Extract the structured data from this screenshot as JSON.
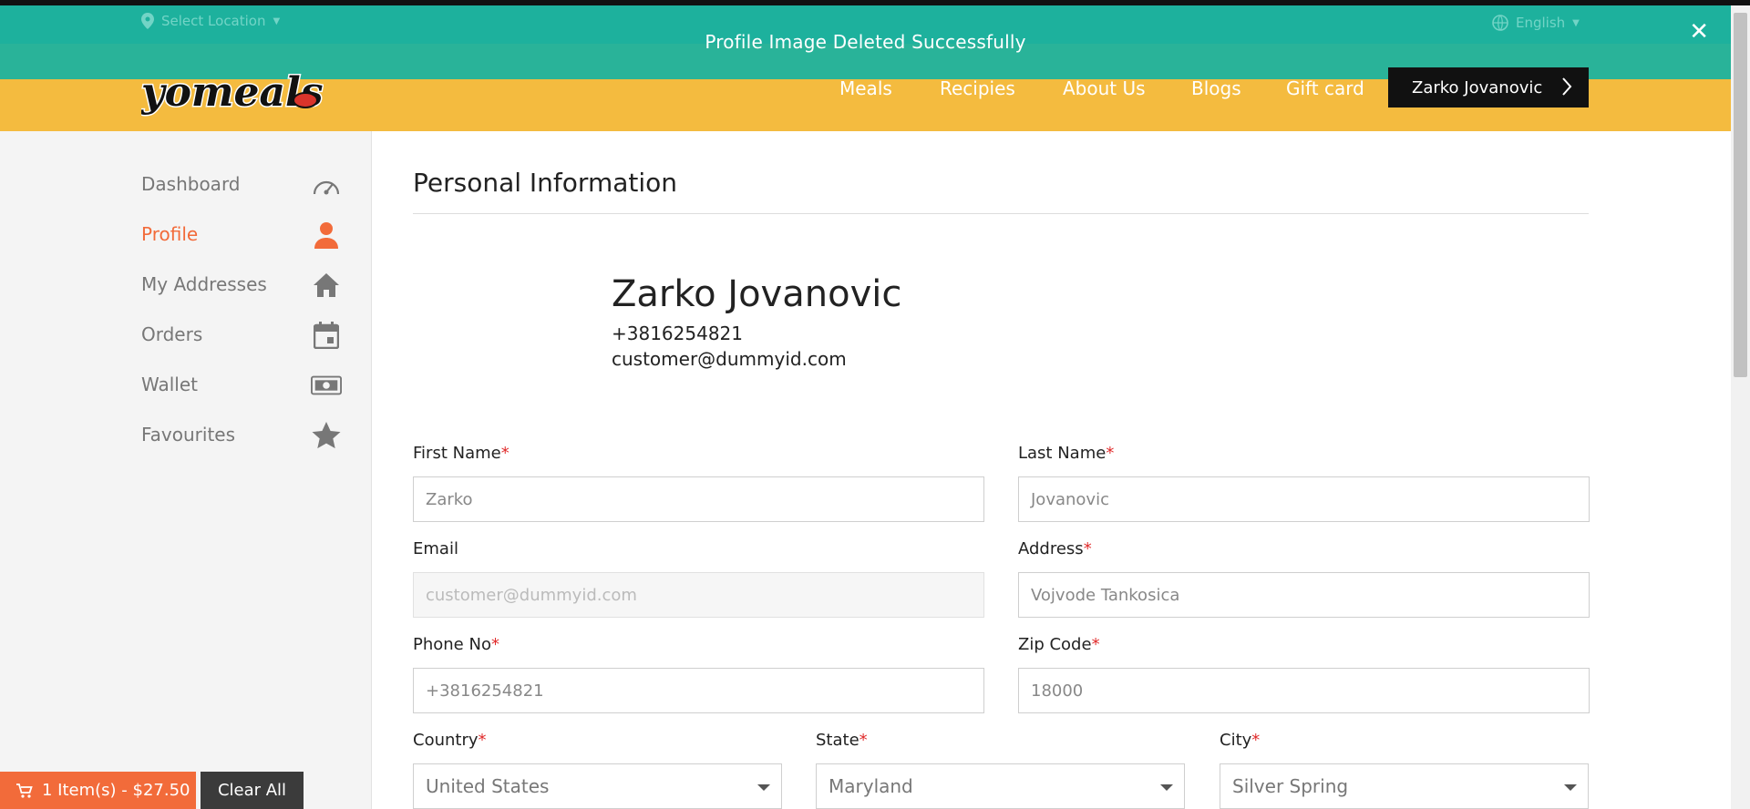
{
  "toast": {
    "message": "Profile Image Deleted Successfully"
  },
  "topbar": {
    "location_label": "Select Location",
    "language_label": "English"
  },
  "brand": {
    "logo_text": "yomeals"
  },
  "nav": {
    "items": [
      {
        "label": "Meals"
      },
      {
        "label": "Recipies"
      },
      {
        "label": "About Us"
      },
      {
        "label": "Blogs"
      },
      {
        "label": "Gift card"
      }
    ],
    "user_button": "Zarko Jovanovic"
  },
  "sidebar": {
    "items": [
      {
        "label": "Dashboard",
        "icon": "speedometer-icon"
      },
      {
        "label": "Profile",
        "icon": "person-icon",
        "active": true
      },
      {
        "label": "My Addresses",
        "icon": "home-icon"
      },
      {
        "label": "Orders",
        "icon": "calendar-icon"
      },
      {
        "label": "Wallet",
        "icon": "money-icon"
      },
      {
        "label": "Favourites",
        "icon": "star-icon"
      }
    ]
  },
  "main": {
    "section_title": "Personal Information",
    "profile": {
      "name": "Zarko Jovanovic",
      "phone": "+3816254821",
      "email": "customer@dummyid.com"
    },
    "form": {
      "first_name": {
        "label": "First Name",
        "value": "Zarko"
      },
      "last_name": {
        "label": "Last Name",
        "value": "Jovanovic"
      },
      "email": {
        "label": "Email",
        "value": "customer@dummyid.com"
      },
      "address": {
        "label": "Address",
        "value": "Vojvode Tankosica"
      },
      "phone": {
        "label": "Phone No",
        "value": "+3816254821"
      },
      "zip": {
        "label": "Zip Code",
        "value": "18000"
      },
      "country": {
        "label": "Country",
        "value": "United States"
      },
      "state": {
        "label": "State",
        "value": "Maryland"
      },
      "city": {
        "label": "City",
        "value": "Silver Spring"
      },
      "required_mark": "*"
    }
  },
  "cart": {
    "summary": "1 Item(s) - $27.50",
    "clear_label": "Clear All"
  },
  "colors": {
    "header": "#f4bb3f",
    "toast": "#1eb29e",
    "accent": "#f26b3a",
    "dark": "#111111"
  }
}
